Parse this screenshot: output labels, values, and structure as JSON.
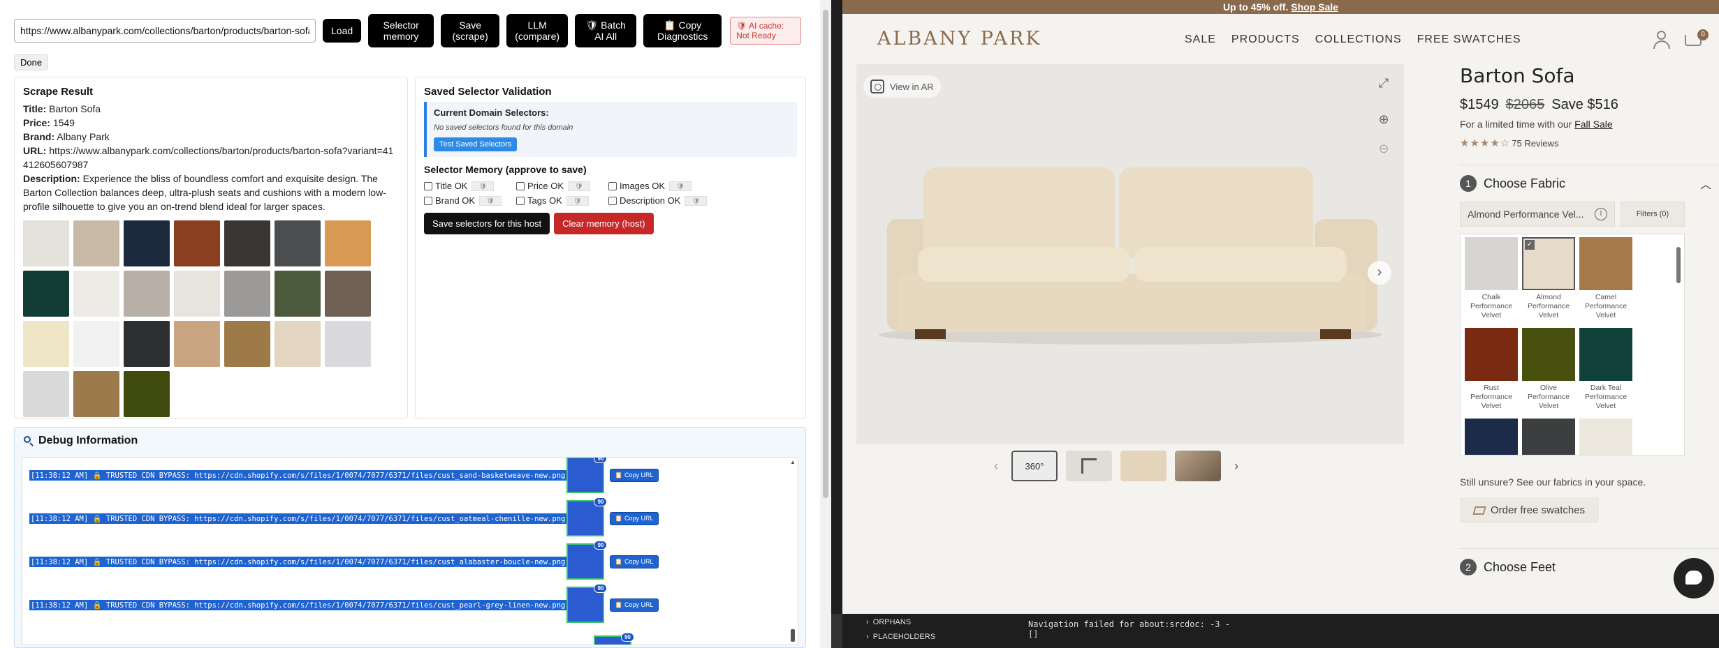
{
  "popup": {
    "url_value": "https://www.albanypark.com/collections/barton/products/barton-sofa?variant=41412605607987",
    "buttons": {
      "load": "Load",
      "selector_memory": "Selector memory",
      "save_scrape": "Save (scrape)",
      "llm_compare": "LLM (compare)",
      "batch_ai_all": "🛡 Batch AI All",
      "copy_diagnostics": "📋 Copy Diagnostics"
    },
    "ai_cache": "🛡 AI cache: Not Ready",
    "status": "Done",
    "scrape": {
      "title": "Scrape Result",
      "title_label": "Title:",
      "title_value": "Barton Sofa",
      "price_label": "Price:",
      "price_value": "1549",
      "brand_label": "Brand:",
      "brand_value": "Albany Park",
      "url_label": "URL:",
      "url_value": "https://www.albanypark.com/collections/barton/products/barton-sofa?variant=41412605607987",
      "desc_label": "Description:",
      "desc_value": "Experience the bliss of boundless comfort and exquisite design. The Barton Collection balances deep, ultra-plush seats and cushions with a modern low-profile silhouette to give you an on-trend blend ideal for larger spaces.",
      "swatch_colors": [
        "#e4e0da",
        "#c8baa6",
        "#1d2a3d",
        "#8a3f20",
        "#3a3634",
        "#4b4d4f",
        "#d99a54",
        "#103c33",
        "#ecebe6",
        "#b8b0a6",
        "#e6e4dc",
        "#9c9a98",
        "#4b5a3c",
        "#6f6154",
        "#efe6c8",
        "#f1f1f1",
        "#2e2f31",
        "#c9a582",
        "#9f7a49",
        "#e2d6c2",
        "#dadadc",
        "#d9d9d9",
        "#9c7a4b",
        "#3f4a0f"
      ]
    },
    "selval": {
      "title": "Saved Selector Validation",
      "current_title": "Current Domain Selectors:",
      "current_info": "No saved selectors found for this domain",
      "test_button": "Test Saved Selectors",
      "memory_title": "Selector Memory (approve to save)",
      "checks": [
        "Title OK",
        "Price OK",
        "Images OK",
        "Brand OK",
        "Tags OK",
        "Description OK"
      ],
      "save_button": "Save selectors for this host",
      "clear_button": "Clear memory (host)"
    },
    "debug": {
      "title": "Debug Information",
      "rows": [
        "[11:38:12 AM] 🔒 TRUSTED CDN BYPASS: https://cdn.shopify.com/s/files/1/0074/7077/6371/files/cust_sand-basketweave-new.png",
        "[11:38:12 AM] 🔒 TRUSTED CDN BYPASS: https://cdn.shopify.com/s/files/1/0074/7077/6371/files/cust_oatmeal-chenille-new.png",
        "[11:38:12 AM] 🔒 TRUSTED CDN BYPASS: https://cdn.shopify.com/s/files/1/0074/7077/6371/files/cust_alabaster-boucle-new.png",
        "[11:38:12 AM] 🔒 TRUSTED CDN BYPASS: https://cdn.shopify.com/s/files/1/0074/7077/6371/files/cust_pearl-grey-linen-new.png"
      ],
      "badge": "90",
      "copy_url": "📋 Copy URL"
    }
  },
  "site": {
    "promo_text": "Up to 45% off.",
    "promo_link": "Shop Sale",
    "logo": "ALBANY PARK",
    "menu": [
      "SALE",
      "PRODUCTS",
      "COLLECTIONS",
      "FREE SWATCHES"
    ],
    "cart_count": "0",
    "view_ar": "View in AR",
    "thumb_360": "360°",
    "product_title": "Barton Sofa",
    "price": "$1549",
    "old_price": "$2065",
    "save": "Save $516",
    "limited": "For a limited time with our",
    "fall_sale": "Fall Sale",
    "stars": "★★★★☆",
    "reviews": "75 Reviews",
    "step1_num": "1",
    "step1_label": "Choose Fabric",
    "fabric_selected": "Almond Performance Vel...",
    "filters": "Filters (0)",
    "fabrics": [
      {
        "name": "Chalk",
        "sub": "Performance Velvet",
        "color": "#d6d5d3"
      },
      {
        "name": "Almond",
        "sub": "Performance Velvet",
        "color": "#e6dac8"
      },
      {
        "name": "Camel",
        "sub": "Performance Velvet",
        "color": "#a67a48"
      },
      {
        "name": "Rust",
        "sub": "Performance Velvet",
        "color": "#7a2a10"
      },
      {
        "name": "Olive",
        "sub": "Performance Velvet",
        "color": "#48500f"
      },
      {
        "name": "Dark Teal",
        "sub": "Performance Velvet",
        "color": "#12403a"
      }
    ],
    "fabric_partial_colors": [
      "#1b2b48",
      "#3c3e40",
      "#ece8de"
    ],
    "unsure": "Still unsure? See our fabrics in your space.",
    "order_swatches": "Order free swatches",
    "step2_num": "2",
    "step2_label": "Choose Feet"
  },
  "terminal": {
    "tree": [
      "ORPHANS",
      "PLACEHOLDERS"
    ],
    "line1": "Navigation failed for about:srcdoc: -3 -",
    "line2": "[]"
  }
}
